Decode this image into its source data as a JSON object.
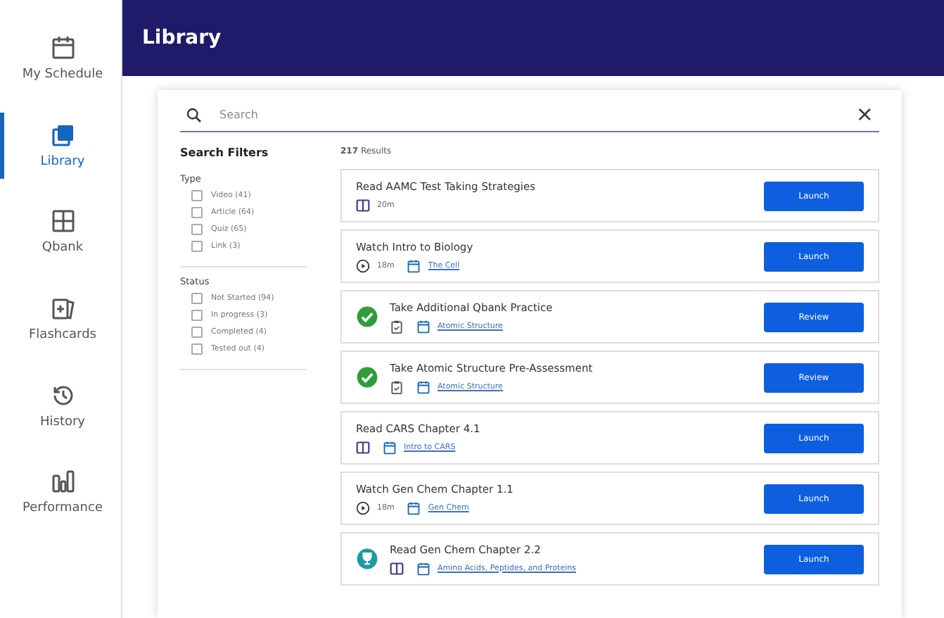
{
  "sidebar": {
    "items": [
      {
        "label": "My Schedule",
        "selected": false
      },
      {
        "label": "Library",
        "selected": true
      },
      {
        "label": "Qbank",
        "selected": false
      },
      {
        "label": "Flashcards",
        "selected": false
      },
      {
        "label": "History",
        "selected": false
      },
      {
        "label": "Performance",
        "selected": false
      }
    ]
  },
  "header": {
    "title": "Library"
  },
  "search": {
    "placeholder": "Search",
    "clear": "×"
  },
  "filters": {
    "title": "Search Filters",
    "groups": [
      {
        "label": "Type",
        "options": [
          {
            "label": "Video (41)",
            "checked": false
          },
          {
            "label": "Article (64)",
            "checked": false
          },
          {
            "label": "Quiz (65)",
            "checked": false
          },
          {
            "label": "Link (3)",
            "checked": false
          }
        ]
      },
      {
        "label": "Status",
        "options": [
          {
            "label": "Not Started (94)",
            "checked": false
          },
          {
            "label": "In progress (3)",
            "checked": false
          },
          {
            "label": "Completed (4)",
            "checked": false
          },
          {
            "label": "Tested out (4)",
            "checked": false
          }
        ]
      }
    ]
  },
  "results": {
    "count": "217",
    "count_label": "Results",
    "items": [
      {
        "title": "Read AAMC Test Taking Strategies",
        "kind": "plain",
        "meta": [
          {
            "kind": "book",
            "text": "20m"
          }
        ],
        "button": "Launch"
      },
      {
        "title": "Watch Intro to Biology",
        "kind": "plain",
        "meta": [
          {
            "kind": "video",
            "text": "18m"
          },
          {
            "kind": "calendar",
            "text": "The Cell"
          }
        ],
        "button": "Launch"
      },
      {
        "title": "Take Additional Qbank Practice",
        "kind": "completed",
        "meta": [
          {
            "kind": "quiz"
          },
          {
            "kind": "calendar",
            "text": "Atomic Structure"
          }
        ],
        "button": "Review"
      },
      {
        "title": "Take Atomic Structure Pre-Assessment",
        "kind": "completed",
        "meta": [
          {
            "kind": "quiz"
          },
          {
            "kind": "calendar",
            "text": "Atomic Structure"
          }
        ],
        "button": "Review"
      },
      {
        "title": "Read CARS Chapter 4.1",
        "kind": "plain",
        "meta": [
          {
            "kind": "book"
          },
          {
            "kind": "calendar",
            "text": "Intro to CARS"
          }
        ],
        "button": "Launch"
      },
      {
        "title": "Watch Gen Chem Chapter 1.1",
        "kind": "plain",
        "meta": [
          {
            "kind": "video",
            "text": "18m"
          },
          {
            "kind": "calendar",
            "text": "Gen Chem"
          }
        ],
        "button": "Launch"
      },
      {
        "title": "Read Gen Chem Chapter 2.2",
        "kind": "badge",
        "meta": [
          {
            "kind": "book"
          },
          {
            "kind": "calendar",
            "text": "Amino Acids, Peptides, and Proteins"
          }
        ],
        "button": "Launch"
      }
    ]
  }
}
